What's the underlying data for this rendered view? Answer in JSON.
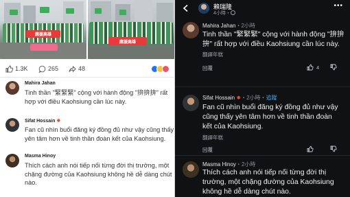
{
  "left_post": {
    "photo_banners": [
      "應援高雄",
      "應援高雄"
    ],
    "reaction_counts": {
      "likes": "1.3K",
      "comments": "265",
      "shares": "48"
    },
    "comments": [
      {
        "name": "Mahira Jahan",
        "lines": [
          "Tinh thần \"緊緊緊\" cộng với hành động \"拚拚拚\" rất",
          "hợp với điều Kaohsiung cần lúc này."
        ]
      },
      {
        "name": "Sifat Hossain",
        "lines": [
          "Fan cũ nhìn buổi đăng ký đồng đủ như vậy cũng thấy",
          "yên tâm hơn về tinh thần đoàn kết của Kaohsiung."
        ]
      },
      {
        "name": "Masma Hinoy",
        "lines": [
          "Thích cách anh nói tiếp nối từng đời thị trường, một",
          "chặng đường của Kaohsiung không hề dễ dàng chút",
          "nào."
        ]
      }
    ]
  },
  "right_post": {
    "author": "賴瑞隆",
    "author_time": "4小時・",
    "comments": [
      {
        "name": "Mahira Jahan",
        "time": "・2小時",
        "follow": "",
        "lines": [
          "Tinh thần \"緊緊緊\" cộng với hành động \"拚拚",
          "拚\" rất hợp với điều Kaohsiung cần lúc này."
        ],
        "translate": "翻譯年糕",
        "reply": "回覆",
        "like_count": "4"
      },
      {
        "name": "Sifat Hossain",
        "time": "・2小時・",
        "follow": "追蹤",
        "lines": [
          "Fan cũ nhìn buổi đăng ký đồng đủ như vậy",
          "cũng thấy yên tâm hơn về tinh thần đoàn",
          "kết của Kaohsiung."
        ],
        "translate": "翻譯年糕",
        "reply": "回覆",
        "like_count": ""
      },
      {
        "name": "Masma Hinoy",
        "time": "・2小時",
        "follow": "",
        "lines": [
          "Thích cách anh nói tiếp nối từng đời thị",
          "trường, một chặng đường của Kaohsiung",
          "không hề dễ dàng chút nào."
        ],
        "translate": "",
        "reply": "",
        "like_count": ""
      }
    ]
  },
  "colors": {
    "facebook_blue": "#1877f2",
    "campaign_green": "#3fae5b",
    "banner_red": "#e83a3a",
    "dark_bg": "#0f1113",
    "follow_blue": "#4aa3f0"
  },
  "icons": [
    "like-icon",
    "comment-icon",
    "share-icon",
    "back-arrow-icon",
    "more-icon",
    "upvote-icon",
    "downvote-icon"
  ]
}
